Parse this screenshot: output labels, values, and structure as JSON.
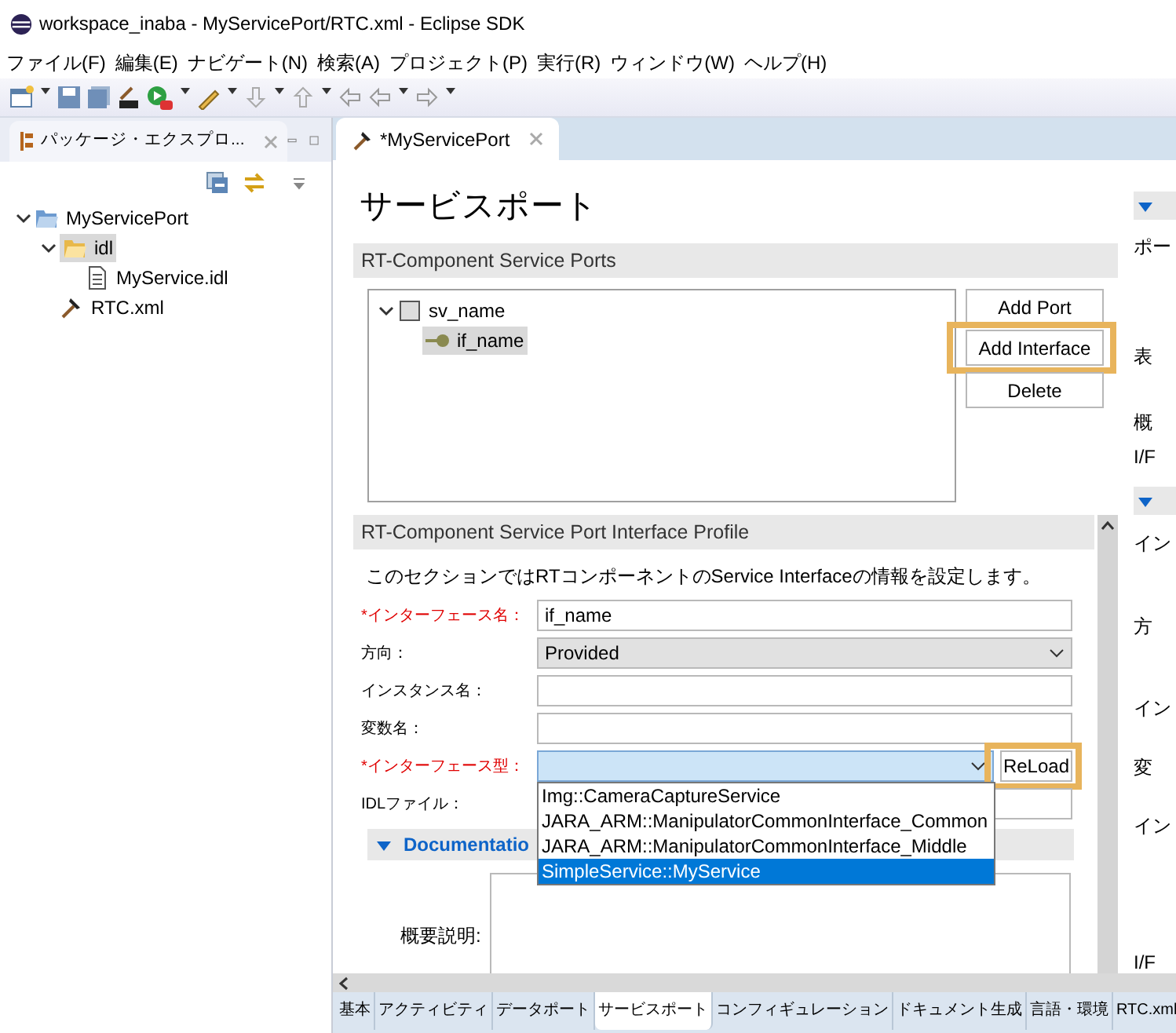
{
  "window": {
    "title": "workspace_inaba - MyServicePort/RTC.xml - Eclipse SDK"
  },
  "menu": [
    "ファイル(F)",
    "編集(E)",
    "ナビゲート(N)",
    "検索(A)",
    "プロジェクト(P)",
    "実行(R)",
    "ウィンドウ(W)",
    "ヘルプ(H)"
  ],
  "explorer": {
    "title": "パッケージ・エクスプロ...",
    "tree": [
      {
        "label": "MyServicePort",
        "kind": "project",
        "expanded": true,
        "selected": false,
        "children": [
          {
            "label": "idl",
            "kind": "folder",
            "expanded": true,
            "selected": true,
            "children": [
              {
                "label": "MyService.idl",
                "kind": "file",
                "selected": false
              }
            ]
          },
          {
            "label": "RTC.xml",
            "kind": "rtc",
            "selected": false
          }
        ]
      }
    ]
  },
  "editor": {
    "tab": "*MyServicePort",
    "heading": "サービスポート",
    "ports_section": {
      "title": "RT-Component Service Ports",
      "tree": [
        {
          "label": "sv_name",
          "kind": "port",
          "expanded": true,
          "selected": false,
          "children": [
            {
              "label": "if_name",
              "kind": "interface",
              "selected": true
            }
          ]
        }
      ],
      "buttons": [
        {
          "label": "Add Port",
          "highlighted": false
        },
        {
          "label": "Add Interface",
          "highlighted": true
        },
        {
          "label": "Delete",
          "highlighted": false
        }
      ]
    },
    "profile_section": {
      "title": "RT-Component Service Port Interface Profile",
      "description": "このセクションではRTコンポーネントのService Interfaceの情報を設定します。",
      "fields": [
        {
          "label": "*インターフェース名：",
          "required": true,
          "kind": "text",
          "value": "if_name"
        },
        {
          "label": "方向：",
          "required": false,
          "kind": "select",
          "value": "Provided"
        },
        {
          "label": "インスタンス名：",
          "required": false,
          "kind": "text"
        },
        {
          "label": "変数名：",
          "required": false,
          "kind": "text"
        },
        {
          "label": "*インターフェース型：",
          "required": true,
          "kind": "combo",
          "button": "ReLoad",
          "button_highlighted": true,
          "options": [
            {
              "label": "Img::CameraCaptureService",
              "selected": false
            },
            {
              "label": "JARA_ARM::ManipulatorCommonInterface_Common",
              "selected": false
            },
            {
              "label": "JARA_ARM::ManipulatorCommonInterface_Middle",
              "selected": false
            },
            {
              "label": "SimpleService::MyService",
              "selected": true
            }
          ]
        },
        {
          "label": "IDLファイル：",
          "required": false,
          "kind": "text"
        }
      ],
      "documentation": {
        "title": "Documentatio",
        "expanded": true,
        "summary_label": "概要説明:"
      }
    },
    "side_column": [
      {
        "kind": "header"
      },
      {
        "kind": "label",
        "text": "ポー"
      },
      {
        "kind": "label",
        "text": "表"
      },
      {
        "kind": "label",
        "text": "概"
      },
      {
        "kind": "label",
        "text": "I/F"
      },
      {
        "kind": "header"
      },
      {
        "kind": "label",
        "text": "イン"
      },
      {
        "kind": "label",
        "text": "方"
      },
      {
        "kind": "label",
        "text": "イン"
      },
      {
        "kind": "label",
        "text": "変"
      },
      {
        "kind": "label",
        "text": "イン"
      },
      {
        "kind": "label",
        "text": "I/F"
      }
    ],
    "bottom_tabs": [
      {
        "label": "基本",
        "selected": false
      },
      {
        "label": "アクティビティ",
        "selected": false
      },
      {
        "label": "データポート",
        "selected": false
      },
      {
        "label": "サービスポート",
        "selected": true
      },
      {
        "label": "コンフィギュレーション",
        "selected": false
      },
      {
        "label": "ドキュメント生成",
        "selected": false
      },
      {
        "label": "言語・環境",
        "selected": false
      },
      {
        "label": "RTC.xml",
        "selected": false
      }
    ]
  }
}
